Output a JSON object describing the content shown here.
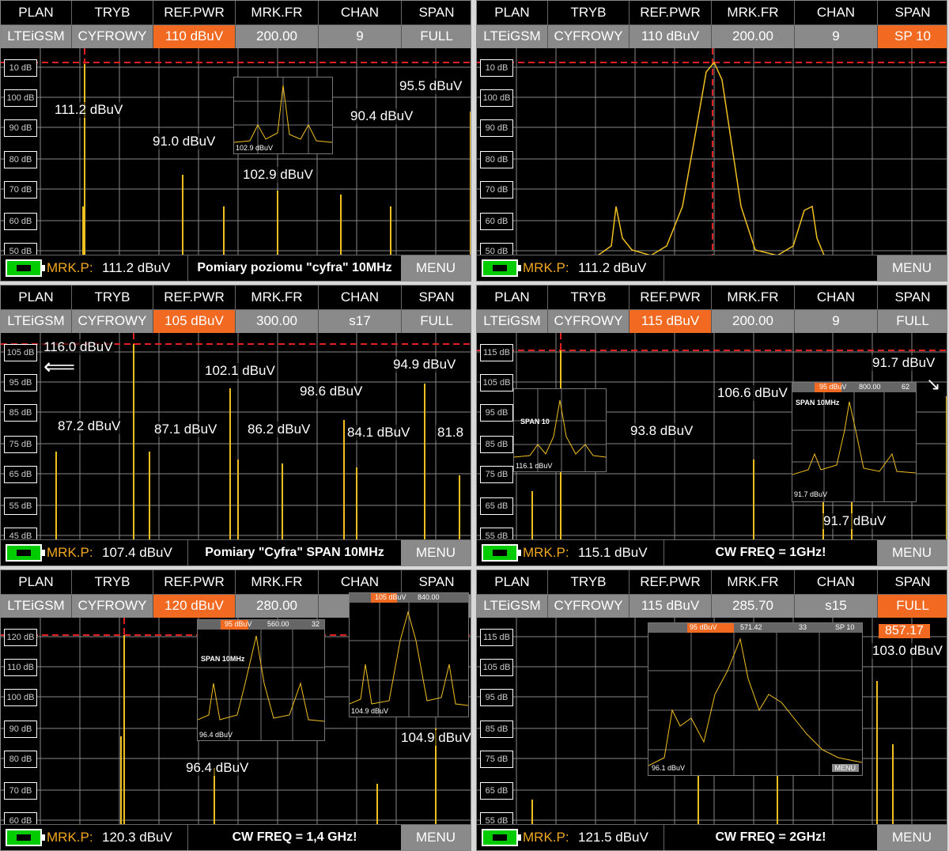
{
  "headers": [
    "PLAN",
    "TRYB",
    "REF.PWR",
    "MRK.FR",
    "CHAN",
    "SPAN"
  ],
  "menu_label": "MENU",
  "mrk_label": "MRK.P:",
  "panels": [
    {
      "values": [
        "LTEiGSM",
        "CYFROWY",
        "110 dBuV",
        "200.00",
        "9",
        "FULL"
      ],
      "highlight": 2,
      "y_labels": [
        "10 dB",
        "100 dB",
        "90 dB",
        "80 dB",
        "70 dB",
        "60 dB",
        "50 dB"
      ],
      "labels": [
        "111.2 dBuV",
        "91.0 dBuV",
        "102.9 dBuV",
        "90.4 dBuV",
        "95.5 dBuV"
      ],
      "mrk_value": "111.2 dBuV",
      "caption": "Pomiary poziomu \"cyfra\" 10MHz",
      "inset_label": "102.9 dBuV"
    },
    {
      "values": [
        "LTEiGSM",
        "CYFROWY",
        "110 dBuV",
        "200.00",
        "9",
        "SP 10"
      ],
      "highlight": 5,
      "y_labels": [
        "10 dB",
        "100 dB",
        "90 dB",
        "80 dB",
        "70 dB",
        "60 dB",
        "50 dB"
      ],
      "labels": [],
      "mrk_value": "111.2 dBuV",
      "caption": ""
    },
    {
      "values": [
        "LTEiGSM",
        "CYFROWY",
        "105 dBuV",
        "300.00",
        "s17",
        "FULL"
      ],
      "highlight": 2,
      "y_labels": [
        "105 dB",
        "95 dB",
        "85 dB",
        "75 dB",
        "65 dB",
        "55 dB",
        "45 dB"
      ],
      "labels": [
        "116.0 dBuV",
        "102.1 dBuV",
        "94.9 dBuV",
        "98.6 dBuV",
        "87.2 dBuV",
        "87.1 dBuV",
        "86.2 dBuV",
        "84.1 dBuV",
        "81.8"
      ],
      "mrk_value": "107.4 dBuV",
      "caption": "Pomiary \"Cyfra\" SPAN 10MHz"
    },
    {
      "values": [
        "LTEiGSM",
        "CYFROWY",
        "115 dBuV",
        "200.00",
        "9",
        "FULL"
      ],
      "highlight": 2,
      "y_labels": [
        "115 dB",
        "105 dB",
        "95 dB",
        "85 dB",
        "75 dB",
        "65 dB",
        "55 dB"
      ],
      "labels": [
        "91.7 dBuV",
        "106.6 dBuV",
        "93.8 dBuV",
        "91.7 dBuV"
      ],
      "mrk_value": "115.1 dBuV",
      "caption": "CW FREQ = 1GHz!",
      "inset_titles": [
        "SPAN 10",
        "SPAN 10MHz"
      ],
      "inset_labels": [
        "116.1 dBuV",
        "91.7 dBuV"
      ],
      "inset_mini": [
        "95 dBuV",
        "800.00",
        "62"
      ]
    },
    {
      "values": [
        "LTEiGSM",
        "CYFROWY",
        "120 dBuV",
        "280.00",
        "",
        ""
      ],
      "highlight": 2,
      "y_labels": [
        "120 dB",
        "110 dB",
        "100 dB",
        "90 dB",
        "80 dB",
        "70 dB",
        "60 dB"
      ],
      "labels": [
        "96.4 dBuV",
        "104.9 dBuV"
      ],
      "mrk_value": "120.3 dBuV",
      "caption": "CW FREQ = 1,4 GHz!",
      "inset_titles": [
        "SPAN 10MHz"
      ],
      "inset_labels": [
        "96.4 dBuV",
        "104.9 dBuV"
      ],
      "inset_mini": [
        "95 dBuV",
        "560.00",
        "32",
        "105 dBuV",
        "840.00"
      ]
    },
    {
      "values": [
        "LTEiGSM",
        "CYFROWY",
        "115 dBuV",
        "285.70",
        "s15",
        "FULL"
      ],
      "highlight": 5,
      "y_labels": [
        "115 dB",
        "105 dB",
        "95 dB",
        "85 dB",
        "75 dB",
        "65 dB",
        "55 dB"
      ],
      "labels": [
        "857.17",
        "103.0 dBuV"
      ],
      "mrk_value": "121.5 dBuV",
      "caption": "CW FREQ = 2GHz!",
      "inset_labels": [
        "96.1 dBuV"
      ],
      "inset_mini": [
        "95 dBuV",
        "571.42",
        "33",
        "SP 10"
      ]
    }
  ]
}
